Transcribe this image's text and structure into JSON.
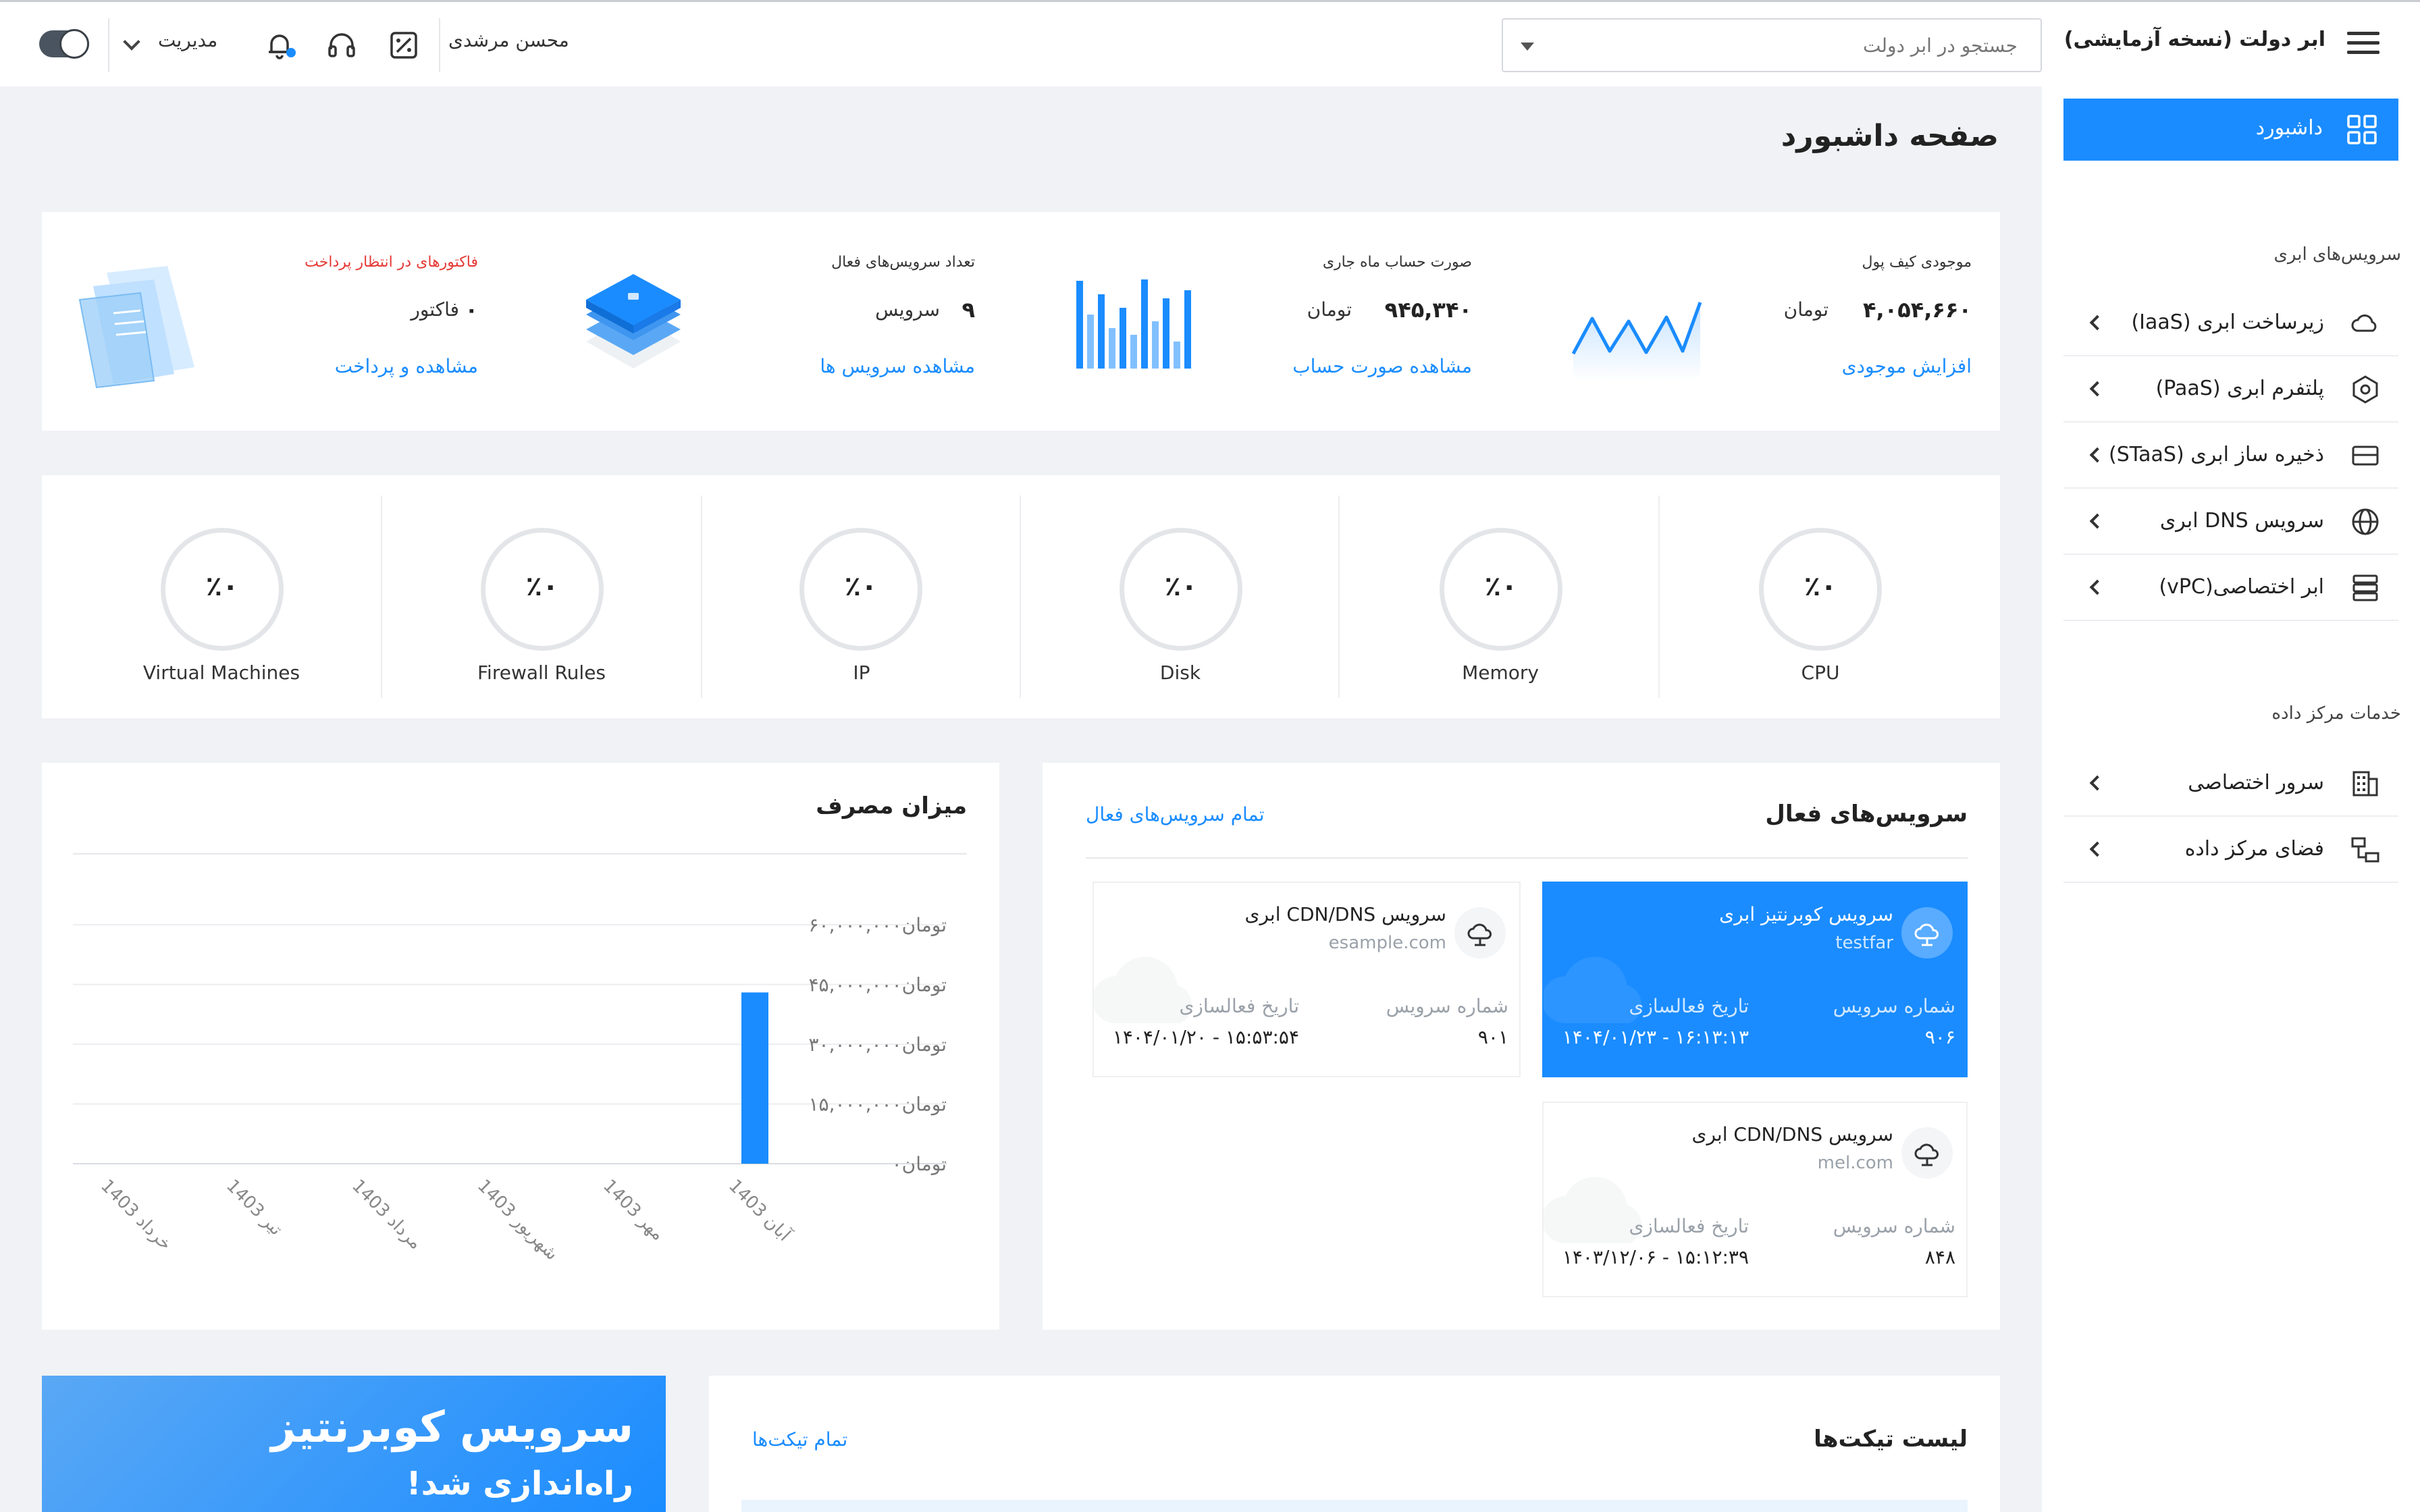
{
  "header": {
    "app_title": "ابر دولت (نسخه آزمایشی)",
    "search_placeholder": "جستجو در ابر دولت",
    "user_name": "محسن مرشدی",
    "role": "مدیریت"
  },
  "sidebar": {
    "active_label": "داشبورد",
    "sections": [
      {
        "title": "سرویس‌های ابری",
        "items": [
          {
            "label": "زیرساخت ابری (IaaS)",
            "icon": "cloud-icon"
          },
          {
            "label": "پلتفرم ابری (PaaS)",
            "icon": "hexagon-icon"
          },
          {
            "label": "ذخیره ساز ابری (STaaS)",
            "icon": "storage-icon"
          },
          {
            "label": "سرویس DNS ابری",
            "icon": "globe-icon"
          },
          {
            "label": "ابر اختصاصی(vPC)",
            "icon": "server-stack-icon"
          }
        ]
      },
      {
        "title": "خدمات مرکز داده",
        "items": [
          {
            "label": "سرور اختصاصی",
            "icon": "building-icon"
          },
          {
            "label": "فضای مرکز داده",
            "icon": "datacenter-icon"
          }
        ]
      }
    ]
  },
  "page": {
    "title": "صفحه داشبورد"
  },
  "summary": {
    "wallet": {
      "title": "موجودی کیف پول",
      "value": "۴,۰۵۴,۶۶۰",
      "unit": "تومان",
      "link": "افزایش موجودی"
    },
    "invoice": {
      "title": "صورت حساب ماه جاری",
      "value": "۹۴۵,۳۴۰",
      "unit": "تومان",
      "link": "مشاهده صورت حساب"
    },
    "services": {
      "title": "تعداد سرویس‌های فعال",
      "value": "۹",
      "unit": "سرویس",
      "link": "مشاهده سرویس ها"
    },
    "pending": {
      "title": "فاکتورهای در انتظار پرداخت",
      "value": "۰",
      "unit": "فاکتور",
      "link": "مشاهده و پرداخت"
    }
  },
  "gauges": [
    {
      "label": "CPU",
      "value": "٪۰"
    },
    {
      "label": "Memory",
      "value": "٪۰"
    },
    {
      "label": "Disk",
      "value": "٪۰"
    },
    {
      "label": "IP",
      "value": "٪۰"
    },
    {
      "label": "Firewall Rules",
      "value": "٪۰"
    },
    {
      "label": "Virtual Machines",
      "value": "٪۰"
    }
  ],
  "active_services": {
    "title": "سرویس‌های فعال",
    "all_link": "تمام سرویس‌های فعال",
    "number_label": "شماره سرویس",
    "date_label": "تاریخ فعالسازی",
    "cards": [
      {
        "name": "سرویس کوبرنتیز ابری",
        "host": "testfar",
        "number": "۹۰۶",
        "date": "۱۴۰۴/۰۱/۲۳ - ۱۶:۱۳:۱۳",
        "active": true
      },
      {
        "name": "سرویس CDN/DNS ابری",
        "host": "esample.com",
        "number": "۹۰۱",
        "date": "۱۴۰۴/۰۱/۲۰ - ۱۵:۵۳:۵۴",
        "active": false
      },
      {
        "name": "سرویس CDN/DNS ابری",
        "host": "mel.com",
        "number": "۸۴۸",
        "date": "۱۴۰۳/۱۲/۰۶ - ۱۵:۱۲:۳۹",
        "active": false
      }
    ]
  },
  "usage": {
    "title": "میزان مصرف"
  },
  "chart_data": {
    "type": "bar",
    "title": "میزان مصرف",
    "categories": [
      "آبان 1403",
      "مهر 1403",
      "شهریور 1403",
      "مرداد 1403",
      "تیر 1403",
      "خرداد 1403"
    ],
    "values": [
      43000000,
      0,
      0,
      0,
      0,
      0
    ],
    "yticks": [
      0,
      15000000,
      30000000,
      45000000,
      60000000
    ],
    "ytick_labels": [
      "۰تومان",
      "۱۵,۰۰۰,۰۰۰تومان",
      "۳۰,۰۰۰,۰۰۰تومان",
      "۴۵,۰۰۰,۰۰۰تومان",
      "۶۰,۰۰۰,۰۰۰تومان"
    ],
    "ylim": [
      0,
      60000000
    ],
    "grid": true,
    "bar_color": "#1a8cff"
  },
  "promo": {
    "line1": "سرویس کوبرنتیز",
    "line2": "راه‌اندازی شد!"
  },
  "tickets": {
    "title": "لیست تیکت‌ها",
    "all_link": "تمام تیکت‌ها"
  },
  "colors": {
    "accent": "#1a8cff",
    "alert": "#e53935",
    "background": "#f0f2f5"
  }
}
